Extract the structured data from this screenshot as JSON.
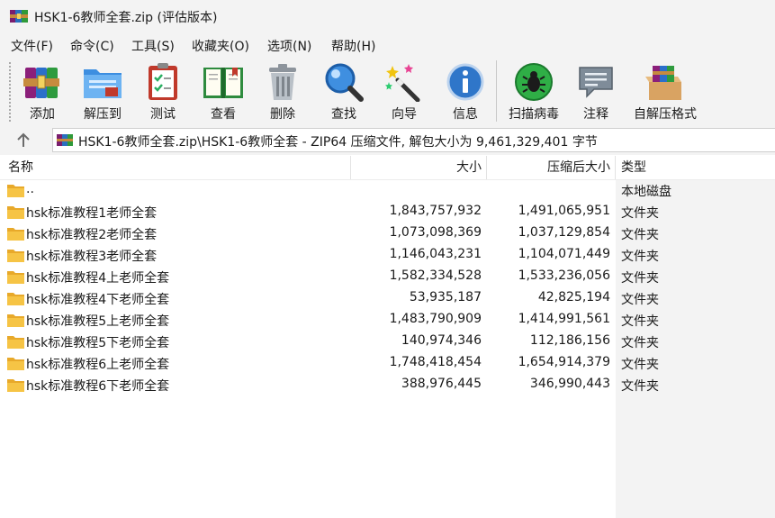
{
  "window": {
    "title": "HSK1-6教师全套.zip (评估版本)",
    "icon": "winrar-archive-icon"
  },
  "menu": [
    {
      "label": "文件(F)"
    },
    {
      "label": "命令(C)"
    },
    {
      "label": "工具(S)"
    },
    {
      "label": "收藏夹(O)"
    },
    {
      "label": "选项(N)"
    },
    {
      "label": "帮助(H)"
    }
  ],
  "toolbar": {
    "add": "添加",
    "extract": "解压到",
    "test": "测试",
    "view": "查看",
    "delete": "删除",
    "find": "查找",
    "wizard": "向导",
    "info": "信息",
    "scan": "扫描病毒",
    "comment": "注释",
    "sfx": "自解压格式"
  },
  "address": {
    "path": "HSK1-6教师全套.zip\\HSK1-6教师全套 - ZIP64 压缩文件, 解包大小为 9,461,329,401 字节"
  },
  "columns": {
    "name": "名称",
    "size": "大小",
    "packed": "压缩后大小",
    "type": "类型"
  },
  "files": [
    {
      "name": "..",
      "size": "",
      "packed": "",
      "type": "本地磁盘"
    },
    {
      "name": "hsk标准教程1老师全套",
      "size": "1,843,757,932",
      "packed": "1,491,065,951",
      "type": "文件夹"
    },
    {
      "name": "hsk标准教程2老师全套",
      "size": "1,073,098,369",
      "packed": "1,037,129,854",
      "type": "文件夹"
    },
    {
      "name": "hsk标准教程3老师全套",
      "size": "1,146,043,231",
      "packed": "1,104,071,449",
      "type": "文件夹"
    },
    {
      "name": "hsk标准教程4上老师全套",
      "size": "1,582,334,528",
      "packed": "1,533,236,056",
      "type": "文件夹"
    },
    {
      "name": "hsk标准教程4下老师全套",
      "size": "53,935,187",
      "packed": "42,825,194",
      "type": "文件夹"
    },
    {
      "name": "hsk标准教程5上老师全套",
      "size": "1,483,790,909",
      "packed": "1,414,991,561",
      "type": "文件夹"
    },
    {
      "name": "hsk标准教程5下老师全套",
      "size": "140,974,346",
      "packed": "112,186,156",
      "type": "文件夹"
    },
    {
      "name": "hsk标准教程6上老师全套",
      "size": "1,748,418,454",
      "packed": "1,654,914,379",
      "type": "文件夹"
    },
    {
      "name": "hsk标准教程6下老师全套",
      "size": "388,976,445",
      "packed": "346,990,443",
      "type": "文件夹"
    }
  ]
}
